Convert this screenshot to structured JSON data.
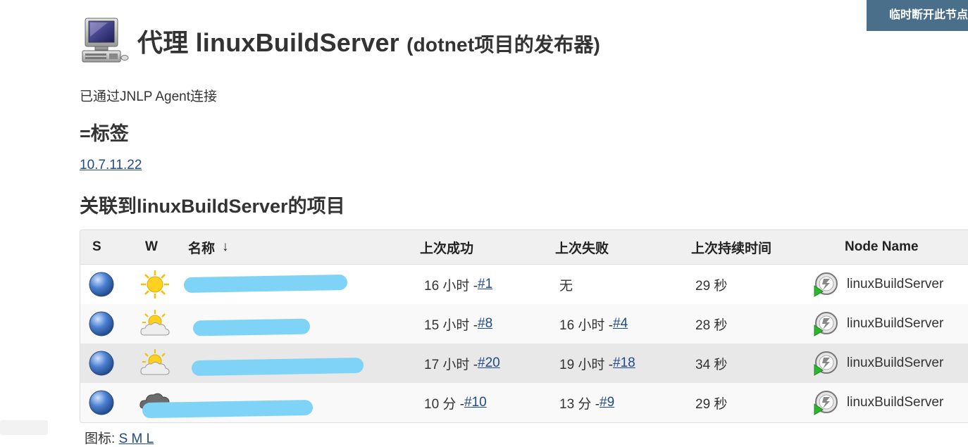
{
  "top_button": {
    "label": "临时断开此节点"
  },
  "header": {
    "title": "代理 linuxBuildServer",
    "description": "(dotnet项目的发布器)",
    "connection_status": "已通过JNLP Agent连接"
  },
  "labels_section": {
    "title": "=标签",
    "labels": [
      "10.7.11.22"
    ]
  },
  "projects_section": {
    "title": "关联到linuxBuildServer的项目",
    "columns": {
      "s": "S",
      "w": "W",
      "name": "名称",
      "sort_indicator": "↓",
      "last_success": "上次成功",
      "last_failure": "上次失败",
      "last_duration": "上次持续时间",
      "node_name": "Node Name"
    },
    "rows": [
      {
        "name": "",
        "last_success_time": "16 小时 - ",
        "last_success_build": "#1",
        "last_failure_time": "无",
        "last_failure_build": "",
        "duration": "29 秒",
        "node": "linuxBuildServer",
        "weather": "sunny"
      },
      {
        "name": "",
        "last_success_time": "15 小时 - ",
        "last_success_build": "#8",
        "last_failure_time": "16 小时 - ",
        "last_failure_build": "#4",
        "duration": "28 秒",
        "node": "linuxBuildServer",
        "weather": "partly-cloudy"
      },
      {
        "name": "",
        "last_success_time": "17 小时 - ",
        "last_success_build": "#20",
        "last_failure_time": "19 小时 - ",
        "last_failure_build": "#18",
        "duration": "34 秒",
        "node": "linuxBuildServer",
        "weather": "partly-cloudy"
      },
      {
        "name": "",
        "last_success_time": "10 分 - ",
        "last_success_build": "#10",
        "last_failure_time": "13 分 - ",
        "last_failure_build": "#9",
        "duration": "29 秒",
        "node": "linuxBuildServer",
        "weather": "storm"
      }
    ]
  },
  "footer": {
    "legend_label": "图标:",
    "size_link": "S M L"
  },
  "colors": {
    "accent_button": "#4a6f8a",
    "link": "#204a87",
    "redaction": "#7fd3f7"
  }
}
